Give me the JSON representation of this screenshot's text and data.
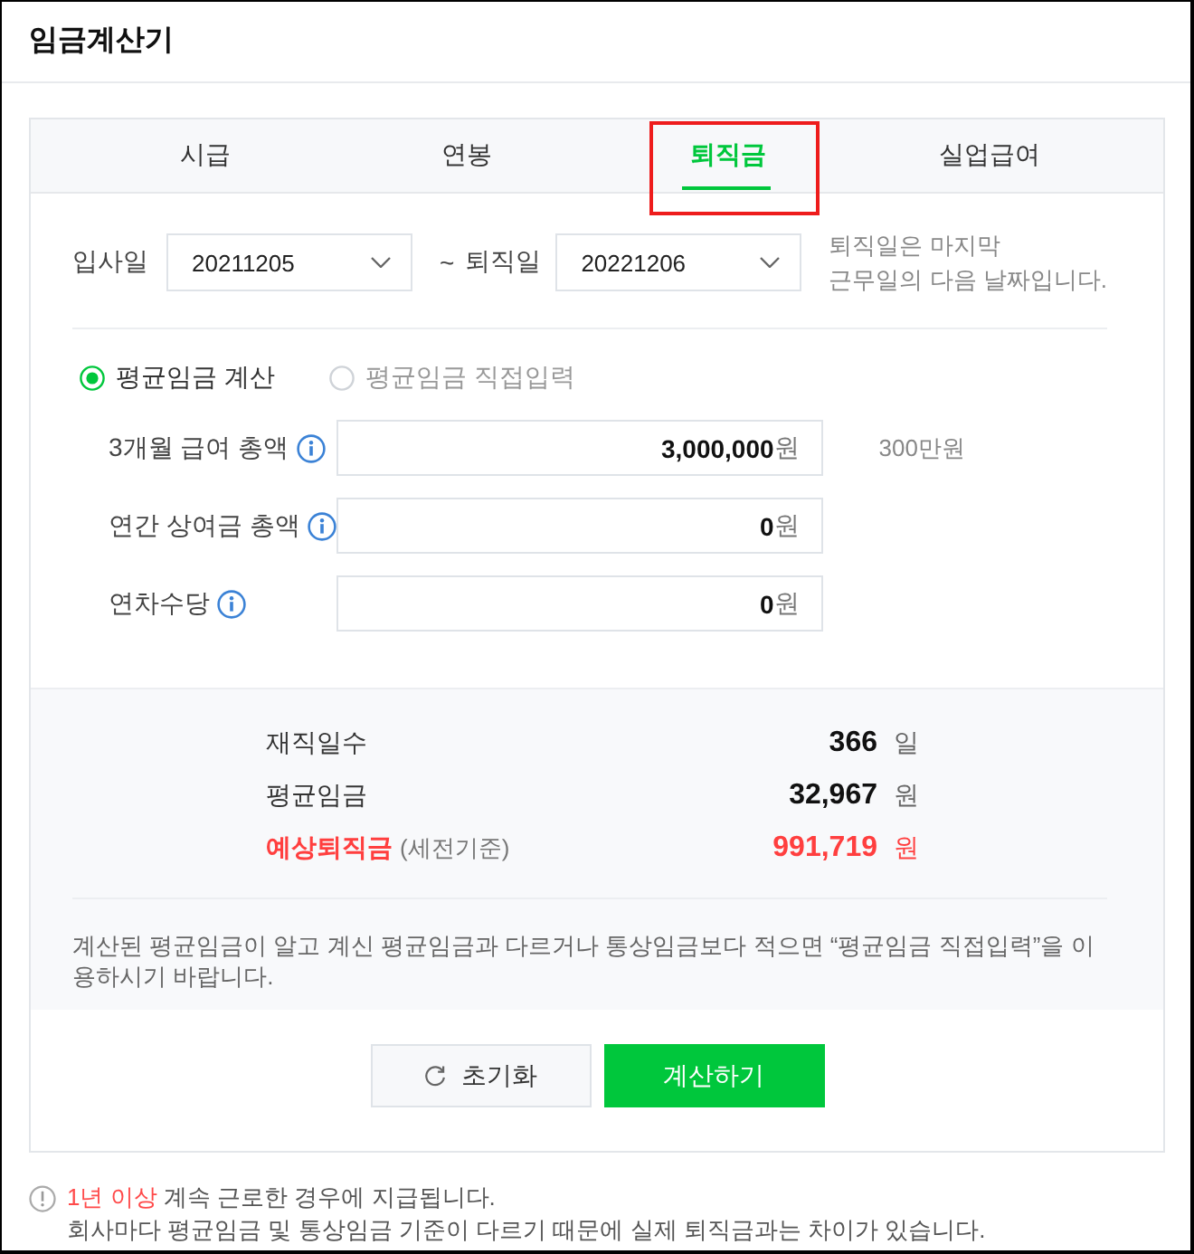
{
  "window": {
    "title": "임금계산기"
  },
  "tabs": [
    {
      "label": "시급",
      "selected": false,
      "highlighted": false
    },
    {
      "label": "연봉",
      "selected": false,
      "highlighted": false
    },
    {
      "label": "퇴직금",
      "selected": true,
      "highlighted": true
    },
    {
      "label": "실업급여",
      "selected": false,
      "highlighted": false
    }
  ],
  "dates": [
    {
      "label": "입사일",
      "value": "20211205"
    },
    {
      "label": "퇴직일",
      "value": "20221206"
    }
  ],
  "date_separator": "~",
  "date_hint": "퇴직일은 마지막\n근무일의 다음 날짜입니다.",
  "modes": [
    {
      "label": "평균임금 계산",
      "selected": true
    },
    {
      "label": "평균임금 직접입력",
      "selected": false
    }
  ],
  "fields": [
    {
      "label": "3개월 급여 총액",
      "value": "3,000,000",
      "unit": "원",
      "note": "300만원"
    },
    {
      "label": "연간 상여금 총액",
      "value": "0",
      "unit": "원"
    },
    {
      "label": "연차수당",
      "value": "0",
      "unit": "원"
    }
  ],
  "results": [
    {
      "kind": "normal",
      "label": "재직일수",
      "value": "366",
      "unit": "일"
    },
    {
      "kind": "normal",
      "label": "평균임금",
      "value": "32,967",
      "unit": "원"
    },
    {
      "kind": "highlight",
      "label": "예상퇴직금",
      "sublabel": "(세전기준)",
      "value": "991,719",
      "unit": "원"
    }
  ],
  "result_note": "계산된 평균임금이 알고 계신 평균임금과 다르거나 통상임금보다 적으면 “평균임금 직접입력”을 이용하시기 바랍니다.",
  "buttons": [
    {
      "kind": "reset",
      "label": "초기화"
    },
    {
      "kind": "primary",
      "label": "계산하기"
    }
  ],
  "notices": [
    {
      "emphasis": "1년 이상",
      "text": "계속 근로한 경우에 지급됩니다."
    },
    {
      "text": "회사마다 평균임금 및 통상임금 기준이 다르기 때문에 실제 퇴직금과는 차이가 있습니다."
    }
  ]
}
